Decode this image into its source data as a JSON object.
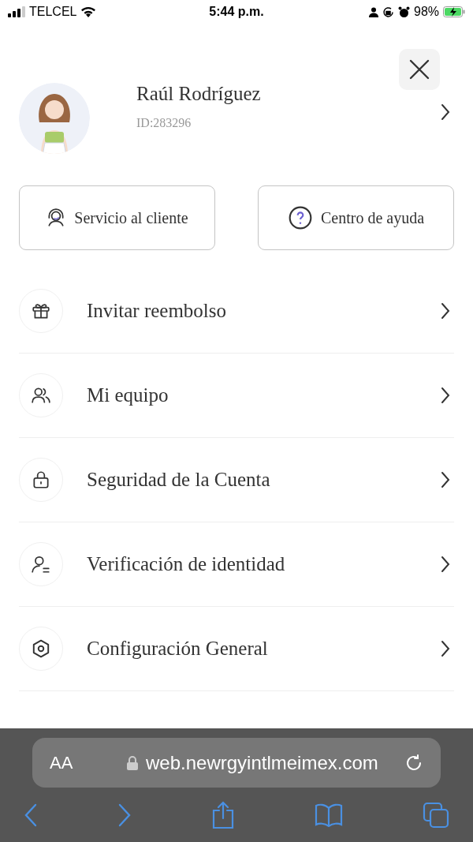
{
  "status_bar": {
    "carrier": "TELCEL",
    "time": "5:44 p.m.",
    "battery": "98%"
  },
  "profile": {
    "name": "Raúl Rodríguez",
    "id": "ID:283296"
  },
  "quick_actions": [
    {
      "kind": "support",
      "label": "Servicio al cliente"
    },
    {
      "kind": "help",
      "label": "Centro de ayuda"
    }
  ],
  "menu": [
    {
      "kind": "gift",
      "label": "Invitar reembolso"
    },
    {
      "kind": "team",
      "label": "Mi equipo"
    },
    {
      "kind": "lock",
      "label": "Seguridad de la Cuenta"
    },
    {
      "kind": "identity",
      "label": "Verificación de identidad"
    },
    {
      "kind": "settings",
      "label": "Configuración General"
    }
  ],
  "browser": {
    "text_size": "AA",
    "url": "web.newrgyintlmeimex.com"
  }
}
